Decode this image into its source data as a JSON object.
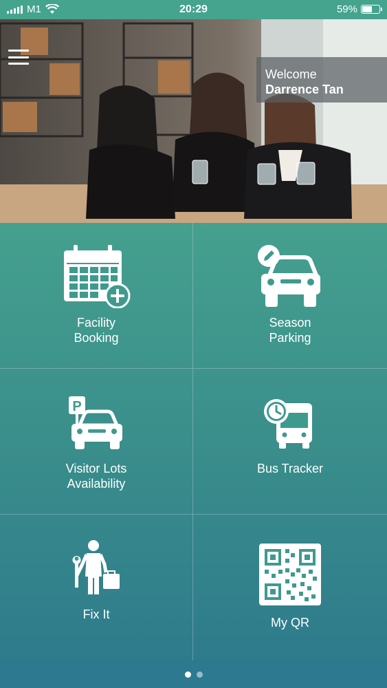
{
  "status_bar": {
    "carrier": "M1",
    "time": "20:29",
    "battery_percent": "59%",
    "battery_level": 0.59,
    "icons": [
      "signal-icon",
      "wifi-icon",
      "battery-icon"
    ]
  },
  "header": {
    "menu_icon": "hamburger-menu-icon",
    "welcome_label": "Welcome",
    "user_name": "Darrence Tan"
  },
  "tiles": [
    {
      "line1": "Facility",
      "line2": "Booking",
      "icon": "calendar-add-icon"
    },
    {
      "line1": "Season",
      "line2": "Parking",
      "icon": "car-edit-icon"
    },
    {
      "line1": "Visitor Lots",
      "line2": "Availability",
      "icon": "parking-car-icon"
    },
    {
      "line1": "Bus Tracker",
      "line2": "",
      "icon": "bus-clock-icon"
    },
    {
      "line1": "Fix It",
      "line2": "",
      "icon": "repairman-icon"
    },
    {
      "line1": "My QR",
      "line2": "",
      "icon": "qr-code-icon"
    }
  ],
  "pagination": {
    "pages": 2,
    "current": 1
  },
  "colors": {
    "status_bar": "#44a48e",
    "grid_top": "#45a08e",
    "grid_bottom": "#2e7b8c",
    "bottom_bar": "#2d7990"
  }
}
